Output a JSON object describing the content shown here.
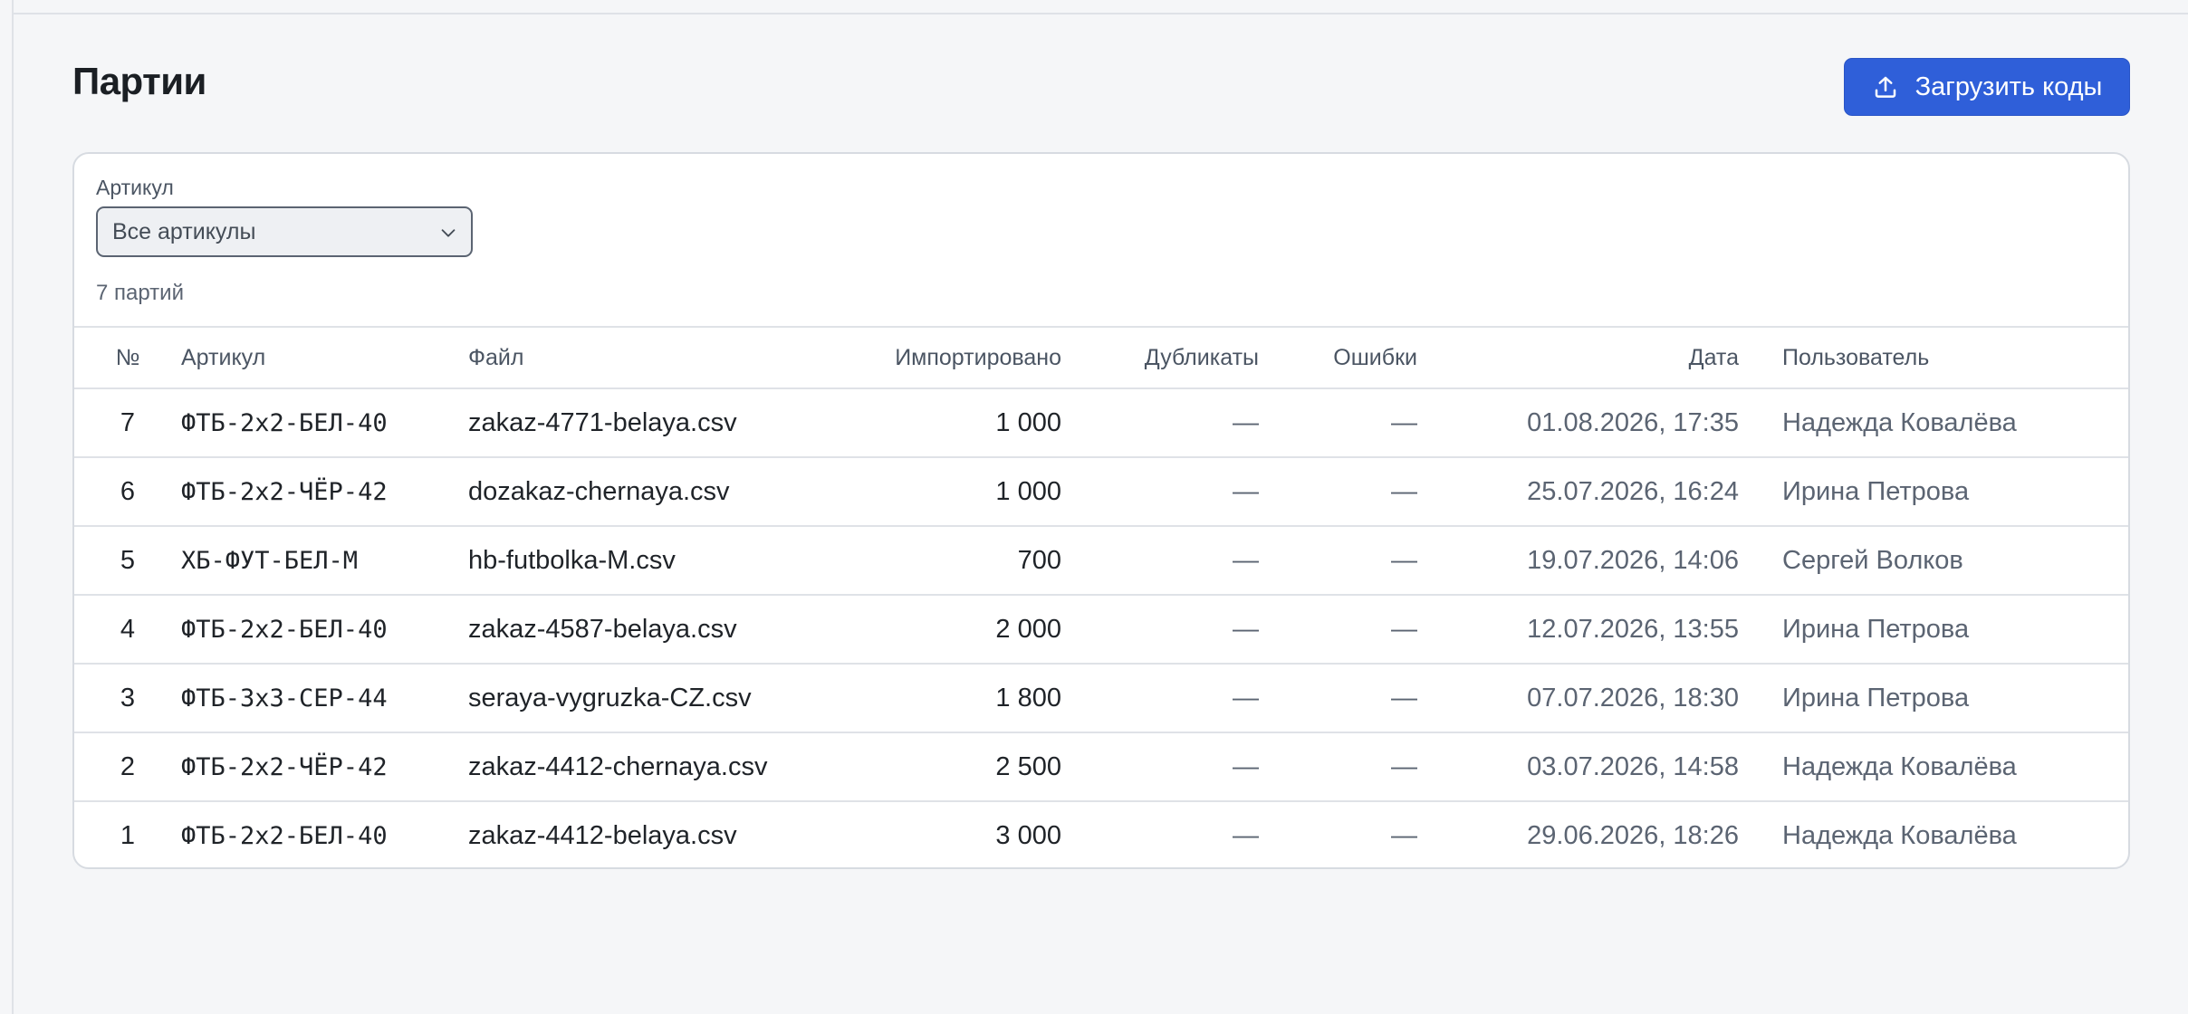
{
  "page": {
    "title": "Партии",
    "upload_label": "Загрузить коды"
  },
  "filter": {
    "label": "Артикул",
    "selected": "Все артикулы",
    "count_text": "7 партий"
  },
  "table": {
    "columns": {
      "num": "№",
      "article": "Артикул",
      "file": "Файл",
      "imported": "Импортировано",
      "duplicates": "Дубликаты",
      "errors": "Ошибки",
      "date": "Дата",
      "user": "Пользователь"
    },
    "rows": [
      {
        "num": "7",
        "article": "ФТБ-2х2-БЕЛ-40",
        "file": "zakaz-4771-belaya.csv",
        "imported": "1 000",
        "duplicates": "—",
        "errors": "—",
        "date": "01.08.2026, 17:35",
        "user": "Надежда Ковалёва"
      },
      {
        "num": "6",
        "article": "ФТБ-2х2-ЧЁР-42",
        "file": "dozakaz-chernaya.csv",
        "imported": "1 000",
        "duplicates": "—",
        "errors": "—",
        "date": "25.07.2026, 16:24",
        "user": "Ирина Петрова"
      },
      {
        "num": "5",
        "article": "ХБ-ФУТ-БЕЛ-М",
        "file": "hb-futbolka-M.csv",
        "imported": "700",
        "duplicates": "—",
        "errors": "—",
        "date": "19.07.2026, 14:06",
        "user": "Сергей Волков"
      },
      {
        "num": "4",
        "article": "ФТБ-2х2-БЕЛ-40",
        "file": "zakaz-4587-belaya.csv",
        "imported": "2 000",
        "duplicates": "—",
        "errors": "—",
        "date": "12.07.2026, 13:55",
        "user": "Ирина Петрова"
      },
      {
        "num": "3",
        "article": "ФТБ-3х3-СЕР-44",
        "file": "seraya-vygruzka-CZ.csv",
        "imported": "1 800",
        "duplicates": "—",
        "errors": "—",
        "date": "07.07.2026, 18:30",
        "user": "Ирина Петрова"
      },
      {
        "num": "2",
        "article": "ФТБ-2х2-ЧЁР-42",
        "file": "zakaz-4412-chernaya.csv",
        "imported": "2 500",
        "duplicates": "—",
        "errors": "—",
        "date": "03.07.2026, 14:58",
        "user": "Надежда Ковалёва"
      },
      {
        "num": "1",
        "article": "ФТБ-2х2-БЕЛ-40",
        "file": "zakaz-4412-belaya.csv",
        "imported": "3 000",
        "duplicates": "—",
        "errors": "—",
        "date": "29.06.2026, 18:26",
        "user": "Надежда Ковалёва"
      }
    ]
  },
  "icons": {
    "upload": "upload-icon",
    "dropdown": "chevron-down-icon"
  },
  "colors": {
    "accent": "#2f5fd9",
    "background": "#f5f6f8",
    "border": "#dfe2e7"
  }
}
